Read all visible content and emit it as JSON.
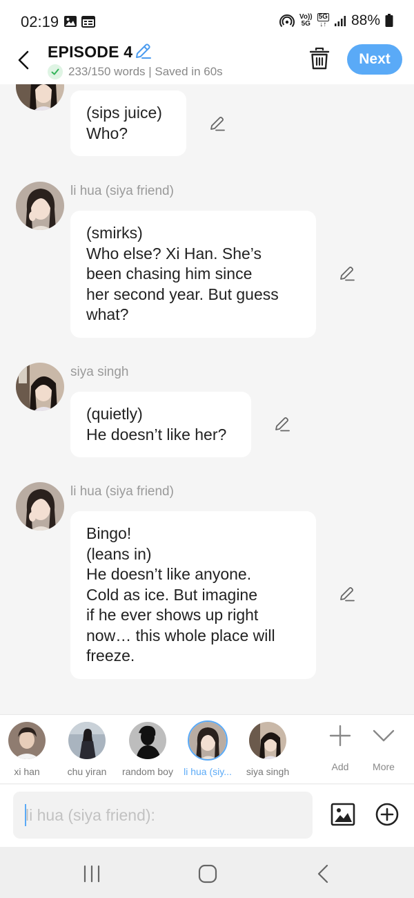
{
  "status_bar": {
    "time": "02:19",
    "volte_label_top": "Vo))",
    "volte_label_bottom": "5G",
    "network_label": "5G",
    "battery": "88%"
  },
  "header": {
    "title": "EPISODE 4",
    "word_status": "233/150 words | Saved in 60s",
    "next_label": "Next"
  },
  "messages": [
    {
      "speaker": "",
      "text": "(sips juice)\nWho?"
    },
    {
      "speaker": "li hua (siya friend)",
      "text": "(smirks)\nWho else? Xi Han. She’s\nbeen chasing him since\nher second year. But guess\nwhat?"
    },
    {
      "speaker": "siya singh",
      "text": "(quietly)\nHe doesn’t like her?"
    },
    {
      "speaker": "li hua (siya friend)",
      "text": "Bingo!\n(leans in)\nHe doesn’t like anyone.\nCold as ice. But imagine\nif he ever shows up right\nnow… this whole place will\nfreeze."
    }
  ],
  "characters": [
    {
      "name": "xi han",
      "selected": false
    },
    {
      "name": "chu yiran",
      "selected": false
    },
    {
      "name": "random boy",
      "selected": false
    },
    {
      "name": "li hua (siy...",
      "selected": true
    },
    {
      "name": "siya singh",
      "selected": false
    }
  ],
  "actions": {
    "add_label": "Add",
    "more_label": "More"
  },
  "input": {
    "placeholder": "li hua (siya friend):"
  },
  "colors": {
    "accent": "#5aaaf7",
    "background": "#f5f5f5",
    "bubble": "#ffffff",
    "muted_text": "#9a9a9a"
  }
}
